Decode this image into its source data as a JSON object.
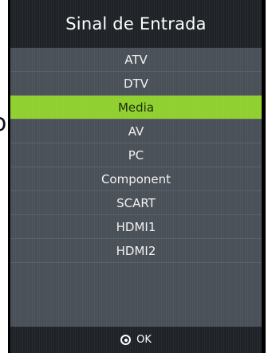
{
  "menu": {
    "title": "Sinal de Entrada",
    "items": [
      {
        "label": "ATV",
        "selected": false
      },
      {
        "label": "DTV",
        "selected": false
      },
      {
        "label": "Media",
        "selected": true
      },
      {
        "label": "AV",
        "selected": false
      },
      {
        "label": "PC",
        "selected": false
      },
      {
        "label": "Component",
        "selected": false
      },
      {
        "label": "SCART",
        "selected": false
      },
      {
        "label": "HDMI1",
        "selected": false
      },
      {
        "label": "HDMI2",
        "selected": false
      }
    ],
    "footer_label": "OK",
    "footer_icon": "ok-button-icon"
  },
  "colors": {
    "header_bg": "#1f2328",
    "list_bg": "#4a5058",
    "selected_bg": "#8fd02f"
  }
}
